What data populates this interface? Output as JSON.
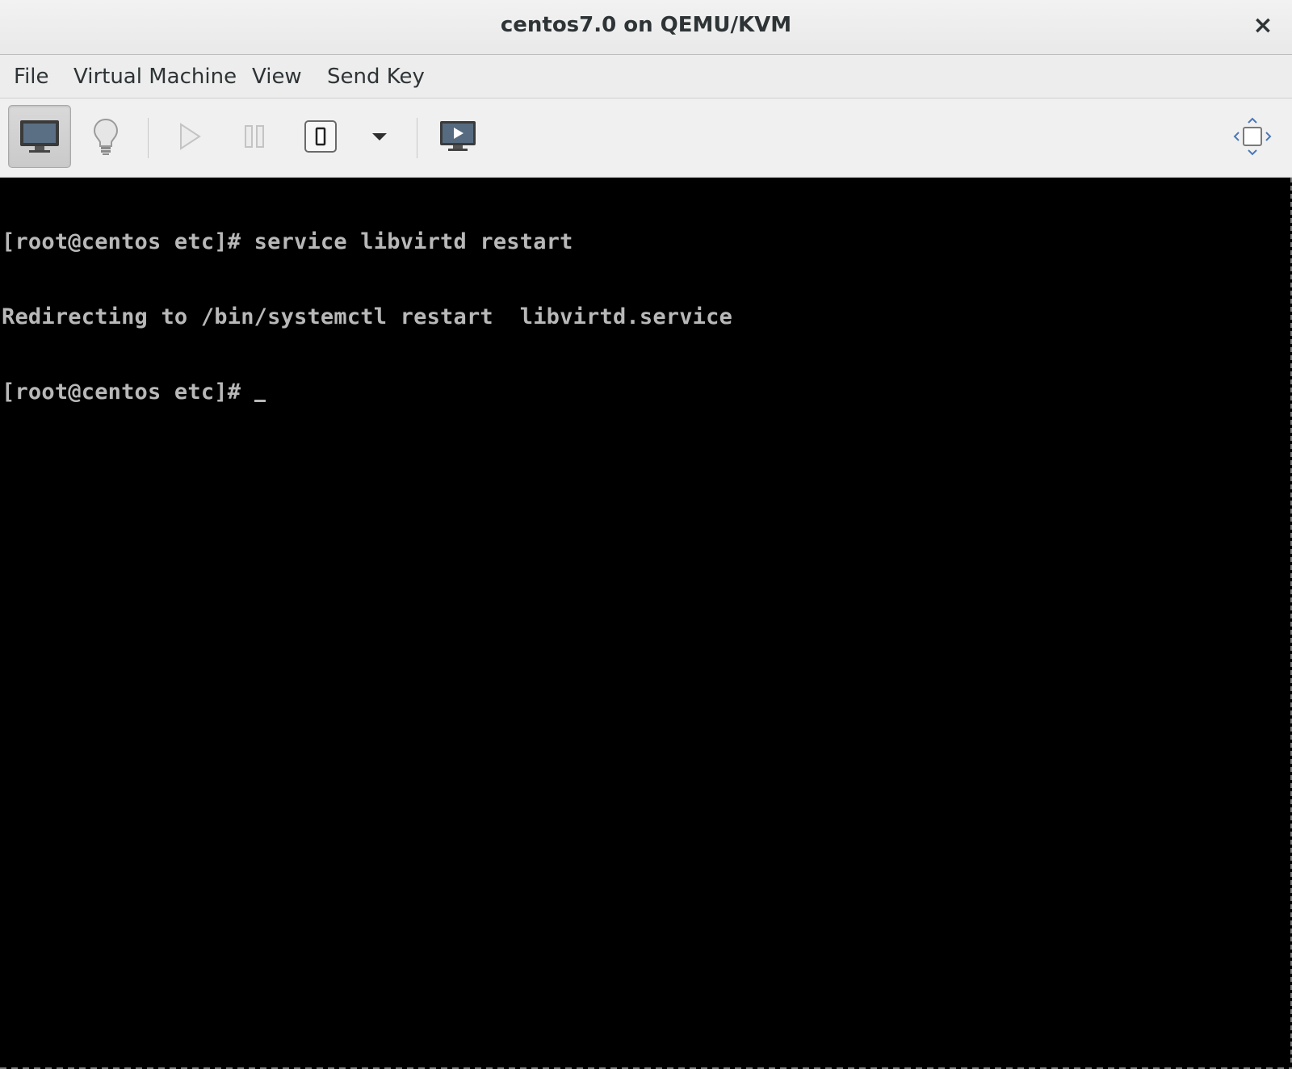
{
  "window": {
    "title": "centos7.0 on QEMU/KVM",
    "close_label": "×"
  },
  "menubar": {
    "items": [
      "File",
      "Virtual Machine",
      "View",
      "Send Key"
    ]
  },
  "toolbar": {
    "buttons": [
      {
        "icon": "monitor-icon",
        "state": "active"
      },
      {
        "icon": "lightbulb-icon",
        "state": "normal"
      },
      {
        "icon": "play-icon",
        "state": "disabled"
      },
      {
        "icon": "pause-icon",
        "state": "disabled"
      },
      {
        "icon": "power-icon",
        "state": "normal"
      },
      {
        "icon": "chevron-down-icon",
        "state": "normal"
      },
      {
        "icon": "screen-play-icon",
        "state": "normal"
      },
      {
        "icon": "fullscreen-icon",
        "state": "normal"
      }
    ]
  },
  "console": {
    "lines": [
      "[root@centos etc]# service libvirtd restart",
      "Redirecting to /bin/systemctl restart  libvirtd.service",
      "[root@centos etc]# "
    ]
  },
  "colors": {
    "console_bg": "#000000",
    "console_fg": "#b8b8b8",
    "chrome_bg": "#ededed"
  }
}
